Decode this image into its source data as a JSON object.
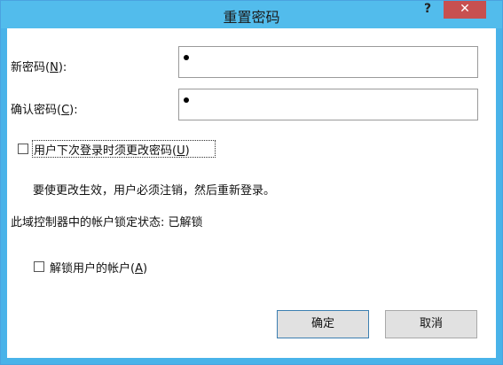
{
  "dialog": {
    "title": "重置密码",
    "help_glyph": "?",
    "close_glyph": "✕"
  },
  "new_password": {
    "label_prefix": "新密码(",
    "label_key": "N",
    "label_suffix": "):"
  },
  "confirm_password": {
    "label_prefix": "确认密码(",
    "label_key": "C",
    "label_suffix": "):"
  },
  "change_at_logon": {
    "label_prefix": "用户下次登录时须更改密码(",
    "label_key": "U",
    "label_suffix": ")",
    "checked": false,
    "note": "要使更改生效，用户必须注销，然后重新登录。"
  },
  "lockout_status": "此域控制器中的帐户锁定状态: 已解锁",
  "unlock_account": {
    "label_prefix": "解锁用户的帐户(",
    "label_key": "A",
    "label_suffix": ")",
    "checked": false
  },
  "buttons": {
    "ok": "确定",
    "cancel": "取消"
  }
}
